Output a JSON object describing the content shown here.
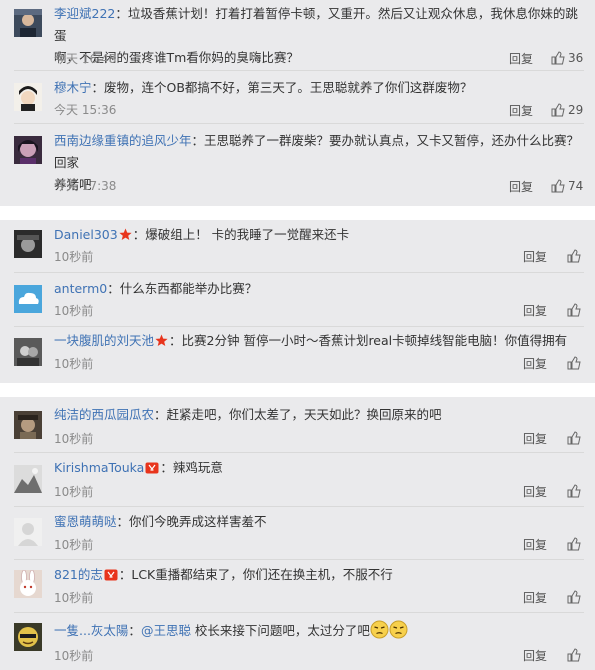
{
  "comments": [
    {
      "user": "李迎斌222",
      "text": "：垃圾香蕉计划！打着打着暂停卡顿，又重开。然后又让观众休息，我休息你妹的跳蛋",
      "text2": "啊，不是闲的蛋疼谁Tm看你妈的臭嗨比赛？",
      "time": "今天 16:48",
      "reply": "回复",
      "likes": "36"
    },
    {
      "user": "穆木宁",
      "text": "：废物，连个OB都搞不好，第三天了。王思聪就养了你们这群废物？",
      "time": "今天 15:36",
      "reply": "回复",
      "likes": "29"
    },
    {
      "user": "西南边缘重镇的追风少年",
      "text": "：王思聪养了一群废柴？要办就认真点，又卡又暂停，还办什么比赛？回家",
      "text2": "养猪吧",
      "time": "今天 17:38",
      "reply": "回复",
      "likes": "74"
    },
    {
      "user": "Daniel303",
      "text": "：爆破组上！ 卡的我睡了一觉醒来还卡",
      "time": "10秒前",
      "reply": "回复"
    },
    {
      "user": "anterm0",
      "text": "：什么东西都能举办比赛？",
      "time": "10秒前",
      "reply": "回复"
    },
    {
      "user": "一块腹肌的刘天池",
      "text": "：比赛2分钟 暂停一小时～香蕉计划real卡顿掉线智能电脑！你值得拥有",
      "time": "10秒前",
      "reply": "回复"
    },
    {
      "user": "纯洁的西瓜园瓜农",
      "text": "：赶紧走吧，你们太差了，天天如此？换回原来的吧",
      "time": "10秒前",
      "reply": "回复"
    },
    {
      "user": "KirishmaTouka",
      "text": "：辣鸡玩意",
      "time": "10秒前",
      "reply": "回复"
    },
    {
      "user": "蜜恩萌萌哒",
      "text": "：你们今晚弄成这样害羞不",
      "time": "10秒前",
      "reply": "回复"
    },
    {
      "user": "821的志",
      "text": "：LCK重播都结束了，你们还在换主机，不服不行",
      "time": "10秒前",
      "reply": "回复"
    },
    {
      "user": "一隻...灰太陽",
      "text": "：",
      "mention": "@王思聪",
      "text_after": " 校长来接下问题吧，太过分了吧",
      "time": "10秒前",
      "reply": "回复"
    }
  ],
  "colors": {
    "name": "#3f72b4",
    "panel": "#eaeaec",
    "star": "#e8341c",
    "vip_badge": "#e8341c"
  }
}
